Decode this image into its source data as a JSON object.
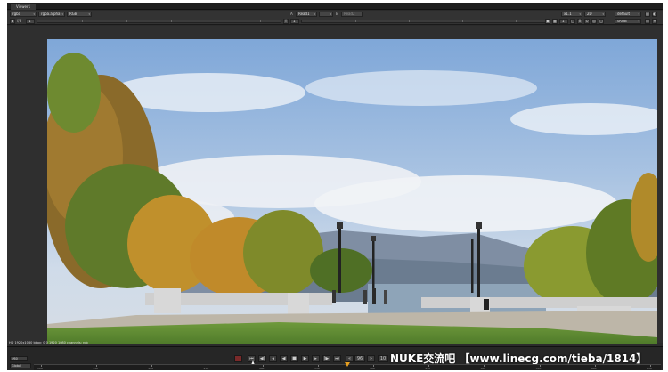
{
  "window": {
    "tab_label": "Viewer1"
  },
  "toolbar_top": {
    "channels": "rgba",
    "layer": "rgba.alpha",
    "colorspace": "RGB",
    "input_a": "Read1",
    "input_b": "Read2",
    "zoom": "x1.1",
    "view_mode": "2D",
    "lut": "default"
  },
  "toolbar_second": {
    "fstop_label": "f/8",
    "fstop_value": "1",
    "gamma_value": "1",
    "colorspace_out": "sRGB",
    "proxy": "1"
  },
  "image_info": "HD 1920x1080  bbox: 0 0 1920 1080  channels: rgb",
  "transport": {
    "fps": "f/60",
    "frame": "96",
    "range_mode": "Global",
    "increment": "10",
    "timeline_ticks": [
      "100",
      "150",
      "200",
      "250",
      "300",
      "350",
      "400",
      "450",
      "500",
      "550",
      "600",
      "650"
    ],
    "timeline_position": 0.5
  },
  "watermark": "NUKE交流吧 【www.linecg.com/tieba/1814】"
}
